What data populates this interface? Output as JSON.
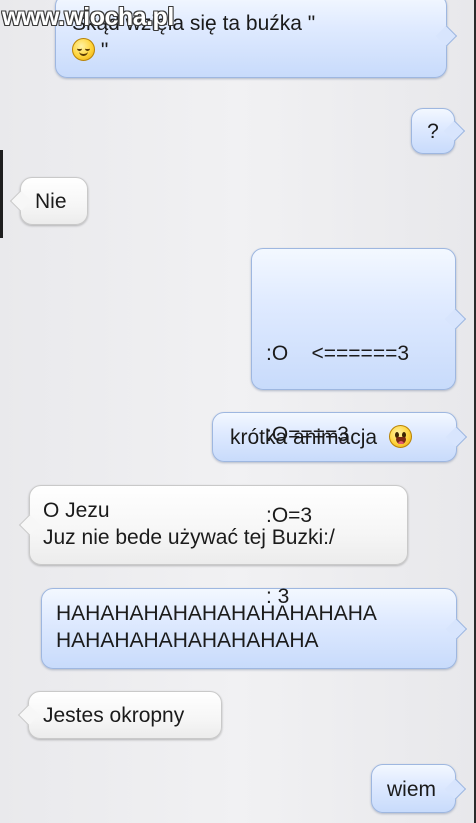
{
  "watermark": "www.wiocha.pl",
  "messages": [
    {
      "direction": "sent",
      "lines": [
        "Skąd wzięła się ta buźka \"",
        "\""
      ],
      "emoji": "smiling-face-icon"
    },
    {
      "direction": "sent",
      "lines": [
        "?"
      ]
    },
    {
      "direction": "received",
      "lines": [
        "Nie"
      ]
    },
    {
      "direction": "sent",
      "lines": [
        ":O    <======3",
        ":O====3",
        ":O=3",
        ": 3"
      ]
    },
    {
      "direction": "sent",
      "lines": [
        "krótka animacja"
      ],
      "emoji": "surprised-face-icon"
    },
    {
      "direction": "received",
      "lines": [
        "O Jezu",
        "Juz nie bede używać tej Buzki:/"
      ]
    },
    {
      "direction": "sent",
      "lines": [
        "HAHAHAHAHAHAHAHAHAHAHA",
        "HAHAHAHAHAHAHAHAHA"
      ]
    },
    {
      "direction": "received",
      "lines": [
        "Jestes okropny"
      ]
    },
    {
      "direction": "sent",
      "lines": [
        "wiem"
      ]
    }
  ]
}
